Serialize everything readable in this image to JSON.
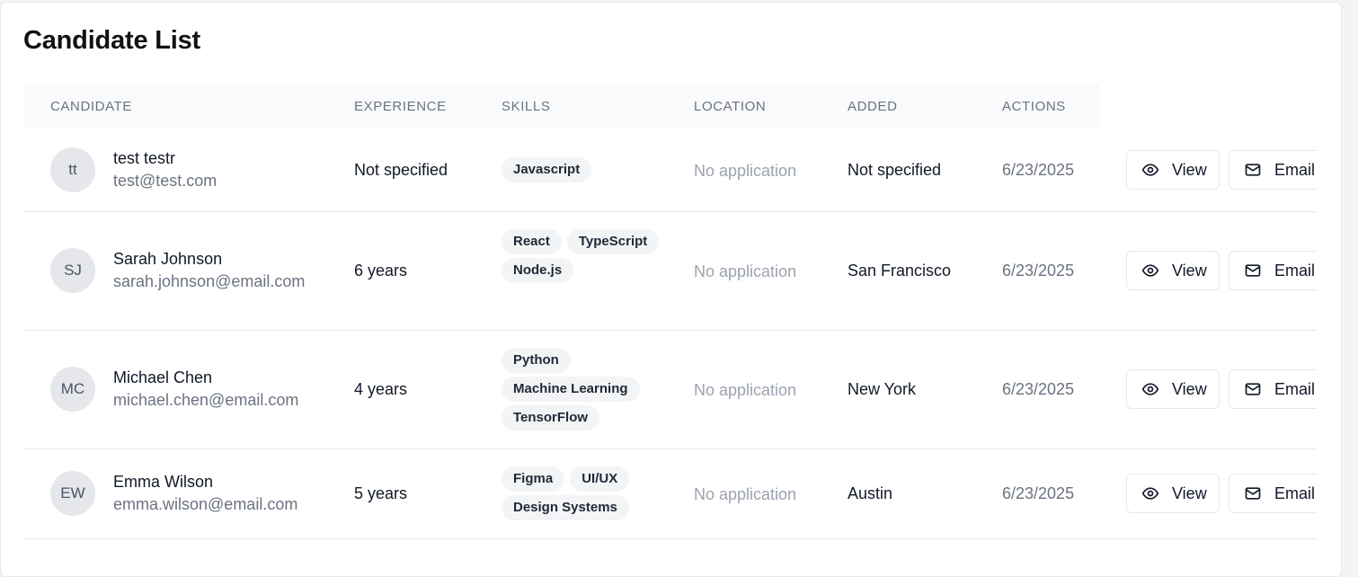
{
  "page": {
    "title": "Candidate List"
  },
  "table": {
    "columns": [
      "CANDIDATE",
      "EXPERIENCE",
      "SKILLS",
      "LOCATION",
      "ADDED",
      "ACTIONS"
    ],
    "view_label": "View",
    "email_label": "Email",
    "rows": [
      {
        "initials": "tt",
        "name": "test testr",
        "email": "test@test.com",
        "experience": "Not specified",
        "skills": [
          "Javascript"
        ],
        "application": "No application",
        "location": "Not specified",
        "added": "6/23/2025"
      },
      {
        "initials": "SJ",
        "name": "Sarah Johnson",
        "email": "sarah.johnson@email.com",
        "experience": "6 years",
        "skills": [
          "React",
          "TypeScript",
          "Node.js"
        ],
        "application": "No application",
        "location": "San Francisco",
        "added": "6/23/2025"
      },
      {
        "initials": "MC",
        "name": "Michael Chen",
        "email": "michael.chen@email.com",
        "experience": "4 years",
        "skills": [
          "Python",
          "Machine Learning",
          "TensorFlow"
        ],
        "application": "No application",
        "location": "New York",
        "added": "6/23/2025"
      },
      {
        "initials": "EW",
        "name": "Emma Wilson",
        "email": "emma.wilson@email.com",
        "experience": "5 years",
        "skills": [
          "Figma",
          "UI/UX",
          "Design Systems"
        ],
        "application": "No application",
        "location": "Austin",
        "added": "6/23/2025"
      }
    ]
  },
  "colors": {
    "header_bg": "#f9fafb",
    "chip_bg": "#f3f4f6",
    "muted_text": "#9ca3af",
    "border": "#e5e7eb"
  },
  "icons": {
    "view": "eye-icon",
    "email": "mail-icon"
  }
}
